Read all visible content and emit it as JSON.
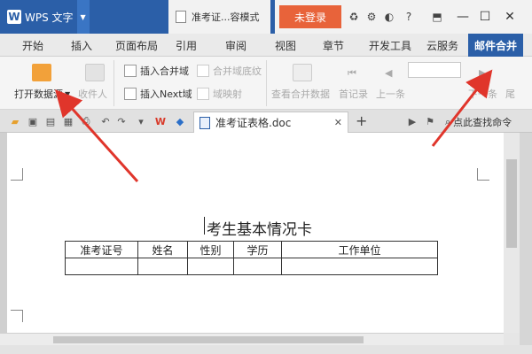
{
  "titlebar": {
    "app_name": "WPS 文字",
    "app_logo": "W",
    "doc_title": "准考证...容模式",
    "login_label": "未登录",
    "icons": [
      "sync-icon",
      "settings-icon",
      "skin-icon",
      "help-icon",
      "pin-icon"
    ],
    "window_buttons": [
      "minimize",
      "maximize",
      "close"
    ]
  },
  "tabs": [
    "开始",
    "插入",
    "页面布局",
    "引用",
    "审阅",
    "视图",
    "章节",
    "开发工具",
    "云服务",
    "邮件合并"
  ],
  "ribbon": {
    "open_source": "打开数据源",
    "recipients": "收件人",
    "insert_merge_field": "插入合并域",
    "merge_field_shading": "合并域底纹",
    "insert_next_field": "插入Next域",
    "field_mapping": "域映射",
    "view_merged_data": "查看合并数据",
    "first_record": "首记录",
    "prev_record": "上一条",
    "next_record": "下一条",
    "last_partial": "尾"
  },
  "quickbar": {
    "doc_tab": "准考证表格.doc",
    "find_label": "点此查找命令"
  },
  "document": {
    "heading": "考生基本情况卡",
    "table_headers": [
      "准考证号",
      "姓名",
      "性别",
      "学历",
      "工作单位"
    ],
    "table_rows": [
      [
        "",
        "",
        "",
        "",
        ""
      ]
    ]
  },
  "colors": {
    "title_blue": "#2b5fa8",
    "login_orange": "#e8633a",
    "arrow_red": "#e0352b"
  }
}
